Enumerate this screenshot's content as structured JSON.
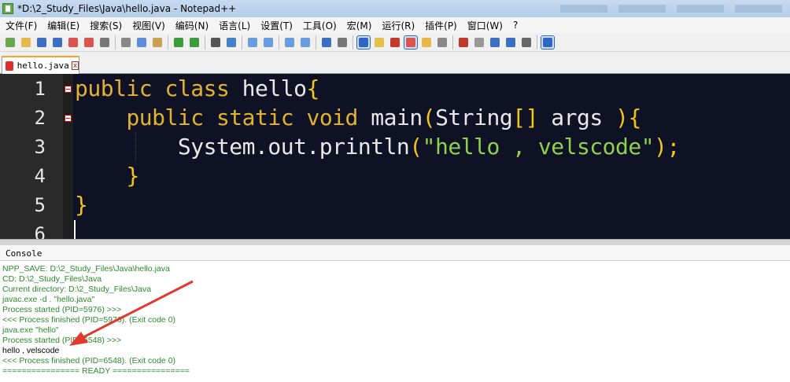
{
  "window": {
    "title": "*D:\\2_Study_Files\\Java\\hello.java - Notepad++"
  },
  "menu": [
    "文件(F)",
    "编辑(E)",
    "搜索(S)",
    "视图(V)",
    "编码(N)",
    "语言(L)",
    "设置(T)",
    "工具(O)",
    "宏(M)",
    "运行(R)",
    "插件(P)",
    "窗口(W)",
    "?"
  ],
  "toolbar_icons": [
    "new-file-icon",
    "open-file-icon",
    "save-icon",
    "save-all-icon",
    "close-icon",
    "close-all-icon",
    "print-icon",
    "cut-icon",
    "copy-icon",
    "paste-icon",
    "undo-icon",
    "redo-icon",
    "find-icon",
    "replace-icon",
    "zoom-in-icon",
    "zoom-out-icon",
    "sync-vertical-icon",
    "sync-horizontal-icon",
    "word-wrap-icon",
    "show-all-chars-icon",
    "indent-guide-icon",
    "lang-icon",
    "function-list-icon",
    "doc-map-icon",
    "folder-icon",
    "monitor-icon",
    "record-macro-icon",
    "stop-macro-icon",
    "play-macro-icon",
    "run-macro-multiple-icon",
    "save-macro-icon",
    "console-toggle-icon"
  ],
  "tab": {
    "label": "hello.java",
    "close": "x"
  },
  "editor": {
    "line_numbers": [
      "1",
      "2",
      "3",
      "4",
      "5",
      "6"
    ],
    "lines": [
      [
        {
          "t": "public",
          "c": "kw"
        },
        {
          "t": " ",
          "c": "id"
        },
        {
          "t": "class",
          "c": "kw"
        },
        {
          "t": " hello",
          "c": "id"
        },
        {
          "t": "{",
          "c": "br"
        }
      ],
      [
        {
          "t": "    ",
          "c": "id"
        },
        {
          "t": "public",
          "c": "kw"
        },
        {
          "t": " ",
          "c": "id"
        },
        {
          "t": "static",
          "c": "kw"
        },
        {
          "t": " ",
          "c": "id"
        },
        {
          "t": "void",
          "c": "kw"
        },
        {
          "t": " main",
          "c": "id"
        },
        {
          "t": "(",
          "c": "br"
        },
        {
          "t": "String",
          "c": "id"
        },
        {
          "t": "[]",
          "c": "br"
        },
        {
          "t": " args ",
          "c": "id"
        },
        {
          "t": ")",
          "c": "br"
        },
        {
          "t": "{",
          "c": "br"
        }
      ],
      [
        {
          "t": "        System.out.println",
          "c": "id"
        },
        {
          "t": "(",
          "c": "br"
        },
        {
          "t": "\"hello , velscode\"",
          "c": "str"
        },
        {
          "t": ");",
          "c": "br"
        }
      ],
      [
        {
          "t": "    ",
          "c": "id"
        },
        {
          "t": "}",
          "c": "br"
        }
      ],
      [
        {
          "t": "}",
          "c": "br"
        }
      ],
      []
    ]
  },
  "console": {
    "title": "Console",
    "lines": [
      {
        "text": "NPP_SAVE: D:\\2_Study_Files\\Java\\hello.java",
        "color": "green"
      },
      {
        "text": "CD: D:\\2_Study_Files\\Java",
        "color": "green"
      },
      {
        "text": "Current directory: D:\\2_Study_Files\\Java",
        "color": "green"
      },
      {
        "text": "javac.exe -d . \"hello.java\"",
        "color": "green"
      },
      {
        "text": "Process started (PID=5976) >>>",
        "color": "green"
      },
      {
        "text": "<<< Process finished (PID=5976). (Exit code 0)",
        "color": "green"
      },
      {
        "text": "java.exe \"hello\"",
        "color": "green"
      },
      {
        "text": "Process started (PID=6548) >>>",
        "color": "green"
      },
      {
        "text": "hello , velscode",
        "color": "black"
      },
      {
        "text": "<<< Process finished (PID=6548). (Exit code 0)",
        "color": "green"
      },
      {
        "text": "================ READY ================",
        "color": "green"
      }
    ]
  },
  "colors": {
    "editor_bg": "#0f1224",
    "keyword": "#e3b22f",
    "string": "#8fd14f",
    "console_text": "#2b8a2b",
    "arrow": "#e03a2f"
  }
}
